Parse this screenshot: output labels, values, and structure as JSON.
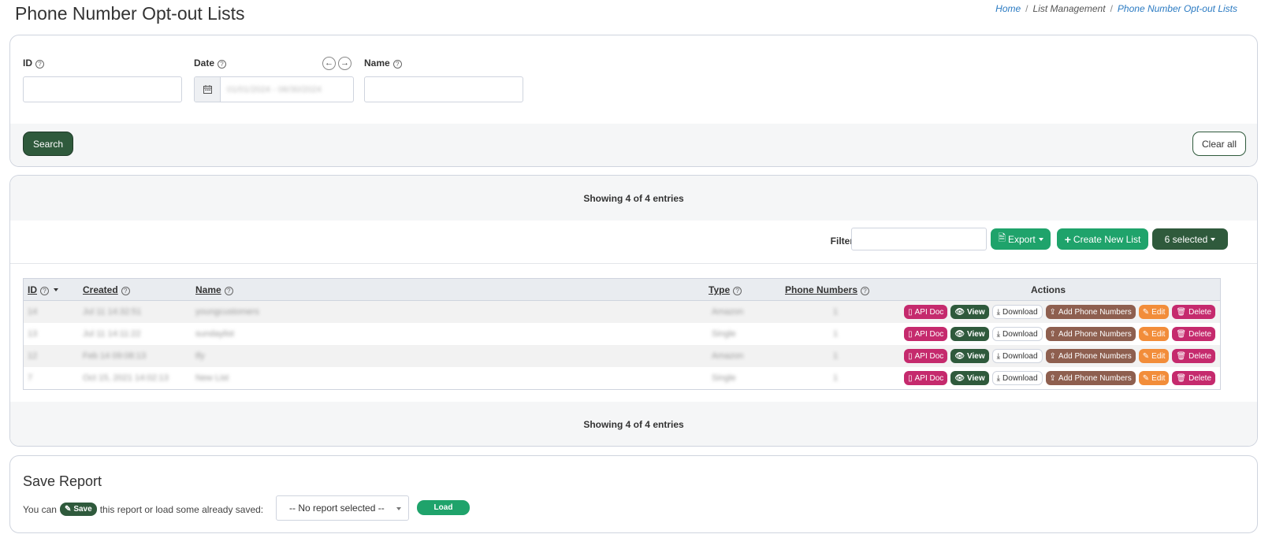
{
  "page": {
    "title": "Phone Number Opt-out Lists"
  },
  "breadcrumb": [
    "Home",
    "List Management",
    "Phone Number Opt-out Lists"
  ],
  "search": {
    "id_label": "ID",
    "date_label": "Date",
    "date_value": "01/01/2024 - 06/30/2024",
    "name_label": "Name",
    "search_button": "Search",
    "clear_button": "Clear all"
  },
  "table": {
    "showing": "Showing 4 of 4 entries",
    "filter_label": "Filter:",
    "export_button": "Export",
    "create_button": "Create New List",
    "selected_button": "6 selected",
    "columns": [
      "ID",
      "Created",
      "Name",
      "Type",
      "Phone Numbers",
      "Actions"
    ],
    "rows": [
      {
        "id": "14",
        "created": "Jul 11 14:32:51",
        "name": "youngcustomers",
        "type": "Amazon",
        "phone": "1"
      },
      {
        "id": "13",
        "created": "Jul 11 14:11:22",
        "name": "sundaylist",
        "type": "Single",
        "phone": "1"
      },
      {
        "id": "12",
        "created": "Feb 14 09:08:13",
        "name": "tfy",
        "type": "Amazon",
        "phone": "1"
      },
      {
        "id": "7",
        "created": "Oct 15, 2021 14:02:13",
        "name": "New List",
        "type": "Single",
        "phone": "1"
      }
    ],
    "actions": {
      "api_doc": "API Doc",
      "view": "View",
      "download": "Download",
      "add_numbers": "Add Phone Numbers",
      "edit": "Edit",
      "delete": "Delete"
    }
  },
  "save_report": {
    "title": "Save Report",
    "text_before": "You can",
    "save_label": "Save",
    "text_after": "this report or load some already saved:",
    "select_value": "-- No report selected --",
    "load_button": "Load"
  }
}
